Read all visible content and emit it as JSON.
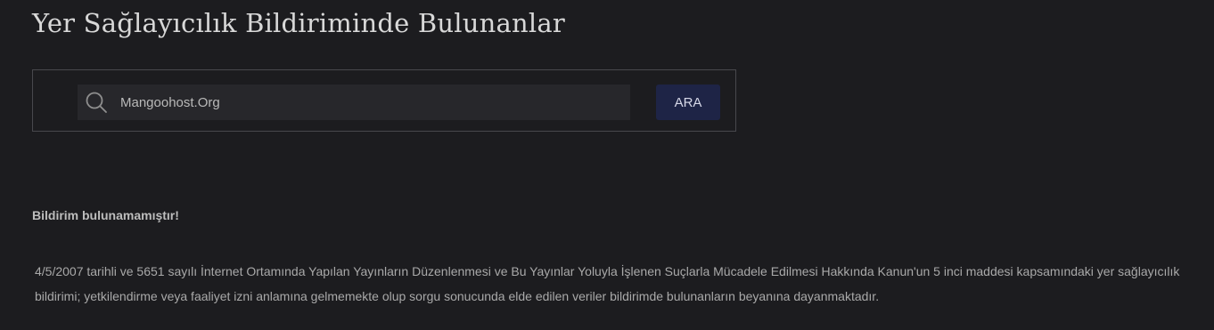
{
  "page": {
    "title": "Yer Sağlayıcılık Bildiriminde Bulunanlar"
  },
  "search": {
    "icon": "search-icon",
    "value": "Mangoohost.Org",
    "button_label": "ARA"
  },
  "result": {
    "status": "Bildirim bulunamamıştır!"
  },
  "notice": {
    "text": "4/5/2007 tarihli ve 5651 sayılı İnternet Ortamında Yapılan Yayınların Düzenlenmesi ve Bu Yayınlar Yoluyla İşlenen Suçlarla Mücadele Edilmesi Hakkında Kanun'un 5 inci maddesi kapsamındaki yer sağlayıcılık bildirimi; yetkilendirme veya faaliyet izni anlamına gelmemekte olup sorgu sonucunda elde edilen veriler bildirimde bulunanların beyanına dayanmaktadır."
  },
  "colors": {
    "background": "#1c1c1f",
    "panel_border": "#48484d",
    "input_background": "#27272b",
    "button_background": "#1e2446"
  }
}
